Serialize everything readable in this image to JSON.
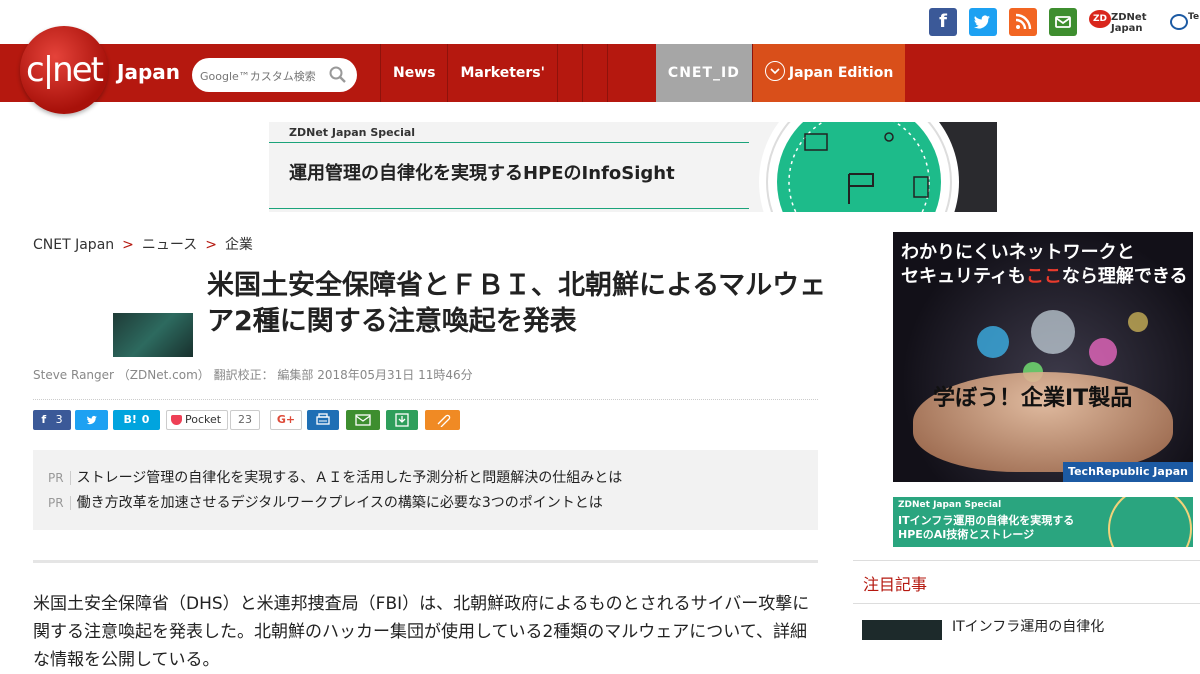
{
  "header": {
    "logo_text": "c|net",
    "logo_sub": "Japan",
    "search_placeholder": "Google™カスタム検索",
    "nav": [
      "News",
      "Marketers'"
    ],
    "cnet_id": "CNET_ID",
    "edition": "Japan Edition"
  },
  "topbar": {
    "zdnet_label": "ZDNet Japan",
    "partial_label": "Te"
  },
  "banner": {
    "label": "ZDNet Japan Special",
    "text": "運用管理の自律化を実現するHPEのInfoSight"
  },
  "breadcrumb": [
    "CNET Japan",
    "ニュース",
    "企業"
  ],
  "article": {
    "title": "米国土安全保障省とＦＢＩ、北朝鮮によるマルウェア2種に関する注意喚起を発表",
    "byline": "Steve Ranger （ZDNet.com） 翻訳校正： 編集部 2018年05月31日 11時46分",
    "share": {
      "facebook_count": "3",
      "hatena_count": "0",
      "pocket_label": "Pocket",
      "pocket_count": "23"
    },
    "pr_tag": "PR",
    "pr": [
      "ストレージ管理の自律化を実現する、ＡＩを活用した予測分析と問題解決の仕組みとは",
      "働き方改革を加速させるデジタルワークプレイスの構築に必要な3つのポイントとは"
    ],
    "body": "米国土安全保障省（DHS）と米連邦捜査局（FBI）は、北朝鮮政府によるものとされるサイバー攻撃に関する注意喚起を発表した。北朝鮮のハッカー集団が使用している2種類のマルウェアについて、詳細な情報を公開している。"
  },
  "sidebar": {
    "ad1_line1": "わかりにくいネットワークと",
    "ad1_line2_pre": "セキュリティも",
    "ad1_line2_hl": "ここ",
    "ad1_line2_post": "なら理解できる",
    "ad1_cta": "学ぼう！企業IT製品",
    "ad1_footer": "TechRepublic Japan",
    "ad2_label": "ZDNet Japan Special",
    "ad2_line1": "ITインフラ運用の自律化を実現する",
    "ad2_line2": "HPEのAI技術とストレージ",
    "section_title": "注目記事",
    "first_link": "ITインフラ運用の自律化"
  },
  "colors": {
    "brand_red": "#b5180f",
    "edition_orange": "#d94f1a",
    "cnet_id_gray": "#a6a6a6"
  }
}
